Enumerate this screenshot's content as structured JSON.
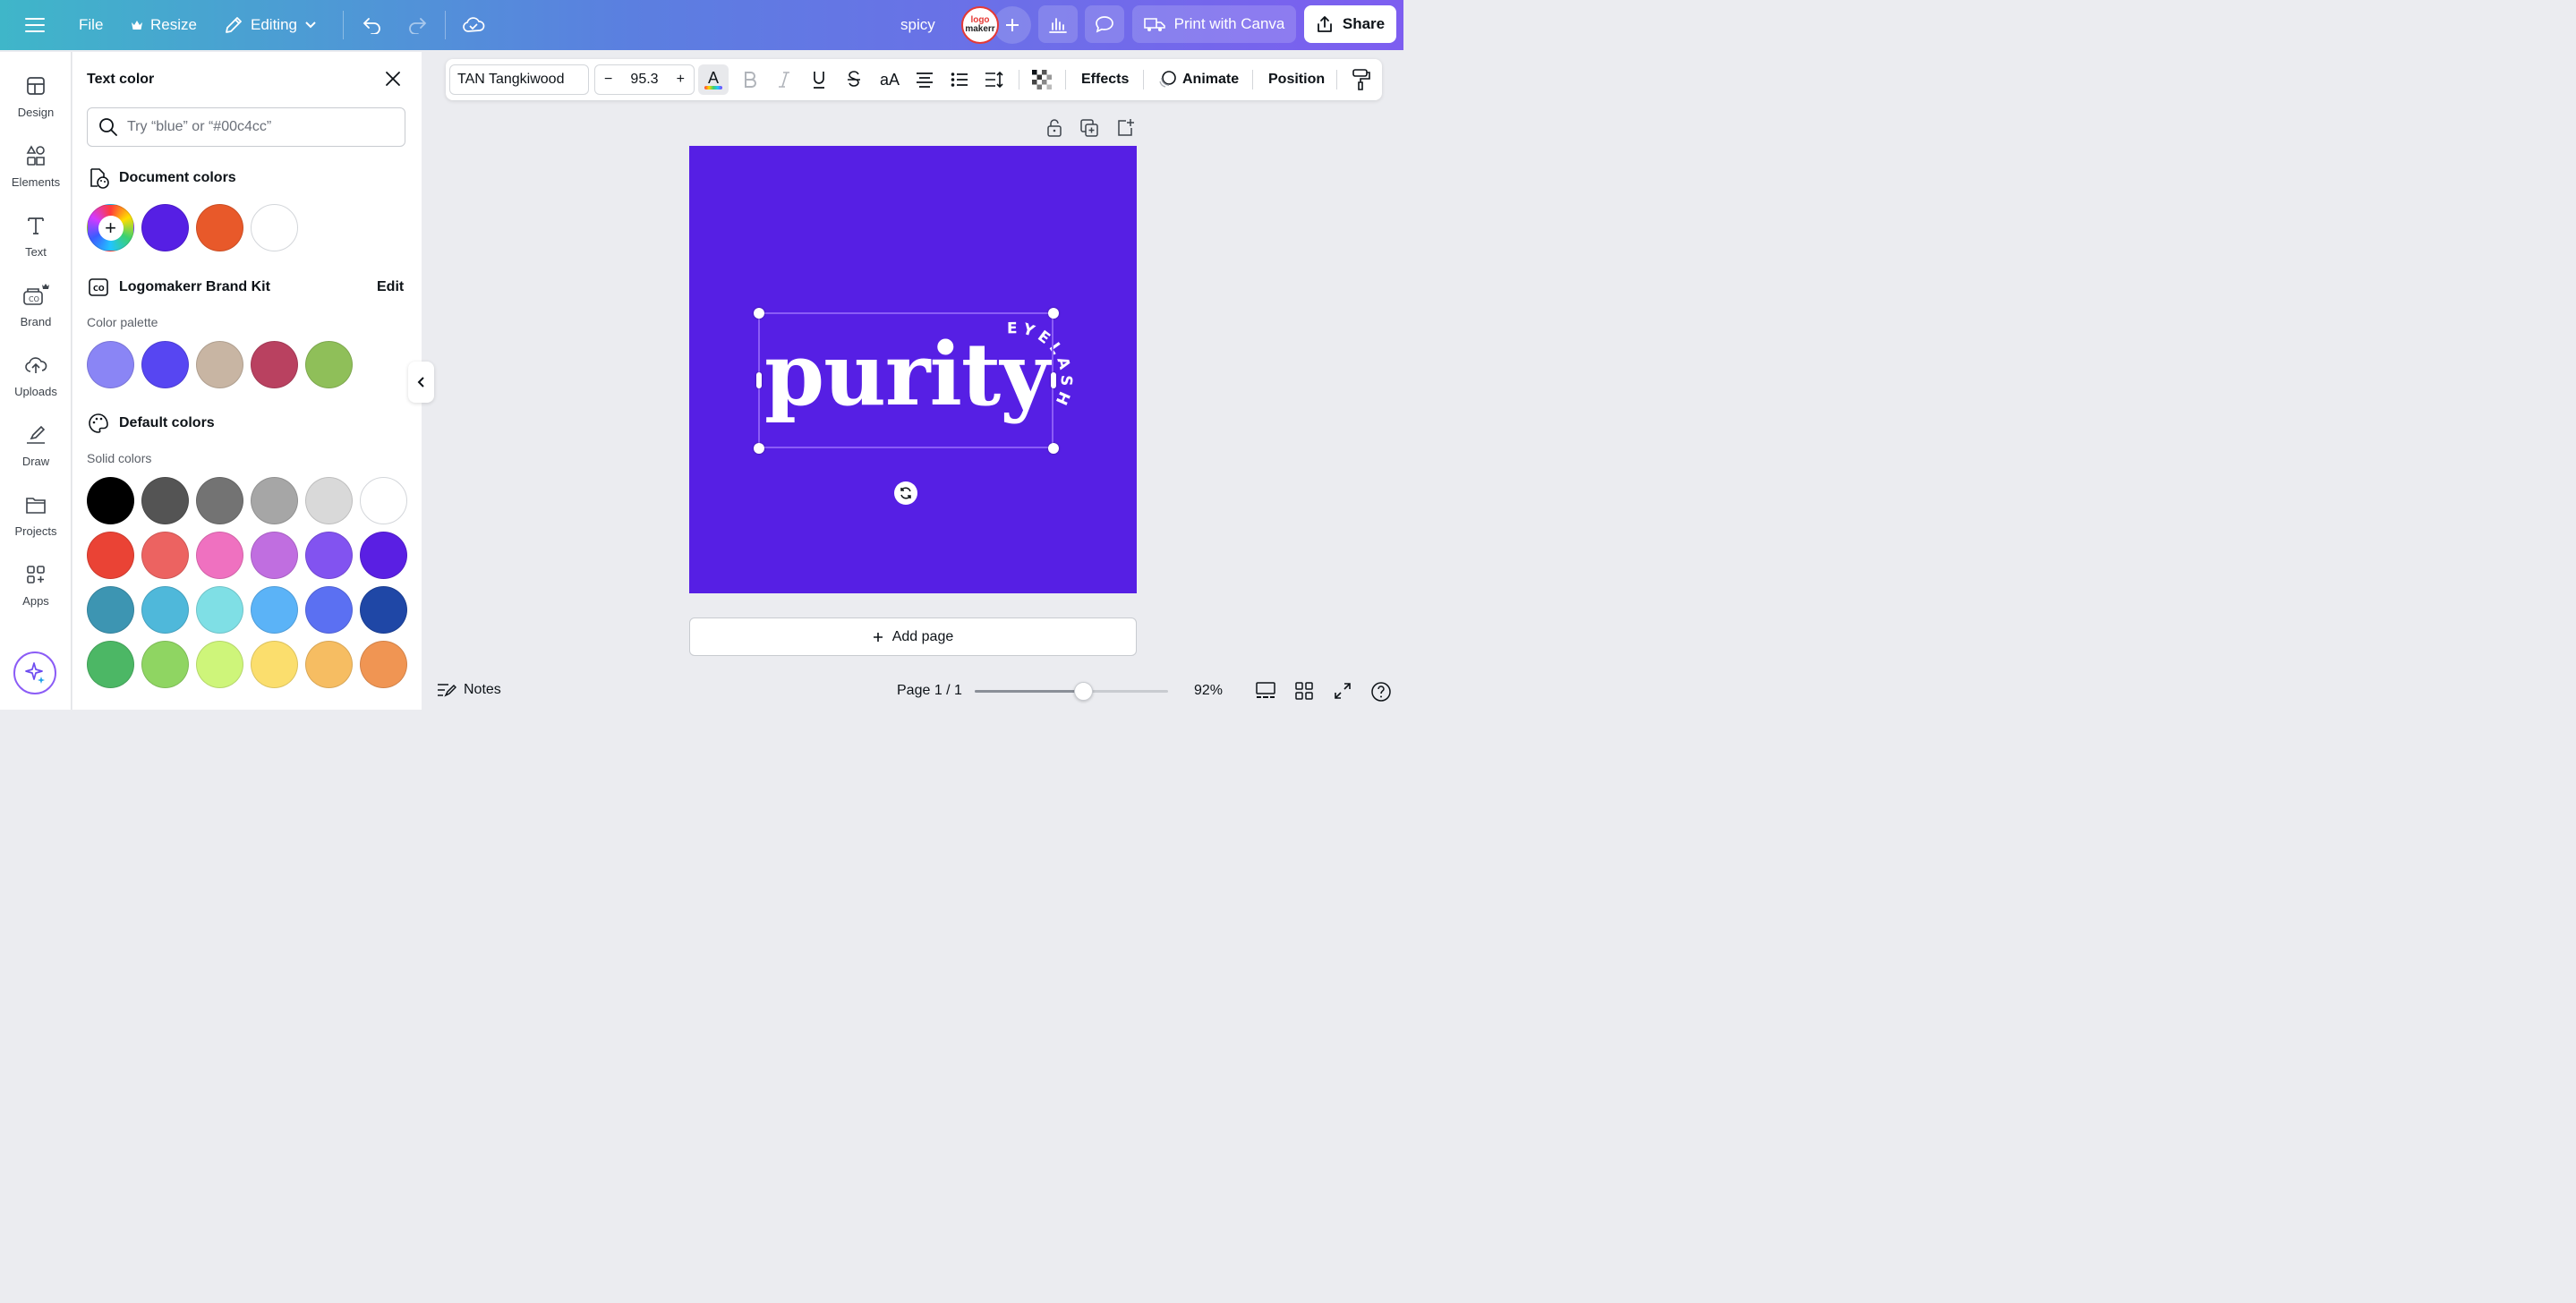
{
  "topbar": {
    "file_label": "File",
    "resize_label": "Resize",
    "editing_label": "Editing",
    "doc_title": "spicy",
    "avatar_line1": "logo",
    "avatar_line2": "makerr",
    "print_label": "Print with Canva",
    "share_label": "Share"
  },
  "rail": {
    "items": [
      {
        "label": "Design",
        "icon": "design-icon"
      },
      {
        "label": "Elements",
        "icon": "elements-icon"
      },
      {
        "label": "Text",
        "icon": "text-icon"
      },
      {
        "label": "Brand",
        "icon": "brand-icon"
      },
      {
        "label": "Uploads",
        "icon": "uploads-icon"
      },
      {
        "label": "Draw",
        "icon": "draw-icon"
      },
      {
        "label": "Projects",
        "icon": "projects-icon"
      },
      {
        "label": "Apps",
        "icon": "apps-icon"
      }
    ],
    "magic_icon": "sparkle-icon"
  },
  "panel": {
    "title": "Text color",
    "search_placeholder": "Try “blue” or “#00c4cc”",
    "document_colors_title": "Document colors",
    "document_colors": [
      "#561fe4",
      "#e8592a",
      "#ffffff"
    ],
    "brand_kit_title": "Logomakerr Brand Kit",
    "brand_kit_edit": "Edit",
    "palette_label": "Color palette",
    "palette_colors": [
      "#8a85f5",
      "#5746f2",
      "#c8b5a3",
      "#b94160",
      "#8fbf59"
    ],
    "default_colors_title": "Default colors",
    "solid_label": "Solid colors",
    "solid_colors": [
      [
        "#000000",
        "#545454",
        "#737373",
        "#a6a6a6",
        "#d9d9d9",
        "#ffffff"
      ],
      [
        "#ea4335",
        "#ec6361",
        "#ef71c0",
        "#c06ee0",
        "#8253f0",
        "#5a1fe3"
      ],
      [
        "#3d95b2",
        "#4fb8da",
        "#7fdfe5",
        "#5bb3f7",
        "#5b70f2",
        "#1f47a6"
      ],
      [
        "#4cb765",
        "#8fd562",
        "#cef57a",
        "#fbde6d",
        "#f6bd62",
        "#f09553"
      ]
    ],
    "selected_color": "#ffffff"
  },
  "toolbar": {
    "font_name": "TAN Tangkiwood",
    "font_size": "95.3",
    "minus": "−",
    "plus": "+",
    "color_glyph": "A",
    "case_label": "aA",
    "effects_label": "Effects",
    "animate_label": "Animate",
    "position_label": "Position"
  },
  "canvas": {
    "page_color": "#561fe4",
    "main_text": "purity",
    "arc_text": "EYELASHES"
  },
  "add_page_label": "Add page",
  "footer": {
    "notes_label": "Notes",
    "page_indicator": "Page 1 / 1",
    "zoom_label": "92%",
    "zoom_fraction": 0.56
  }
}
